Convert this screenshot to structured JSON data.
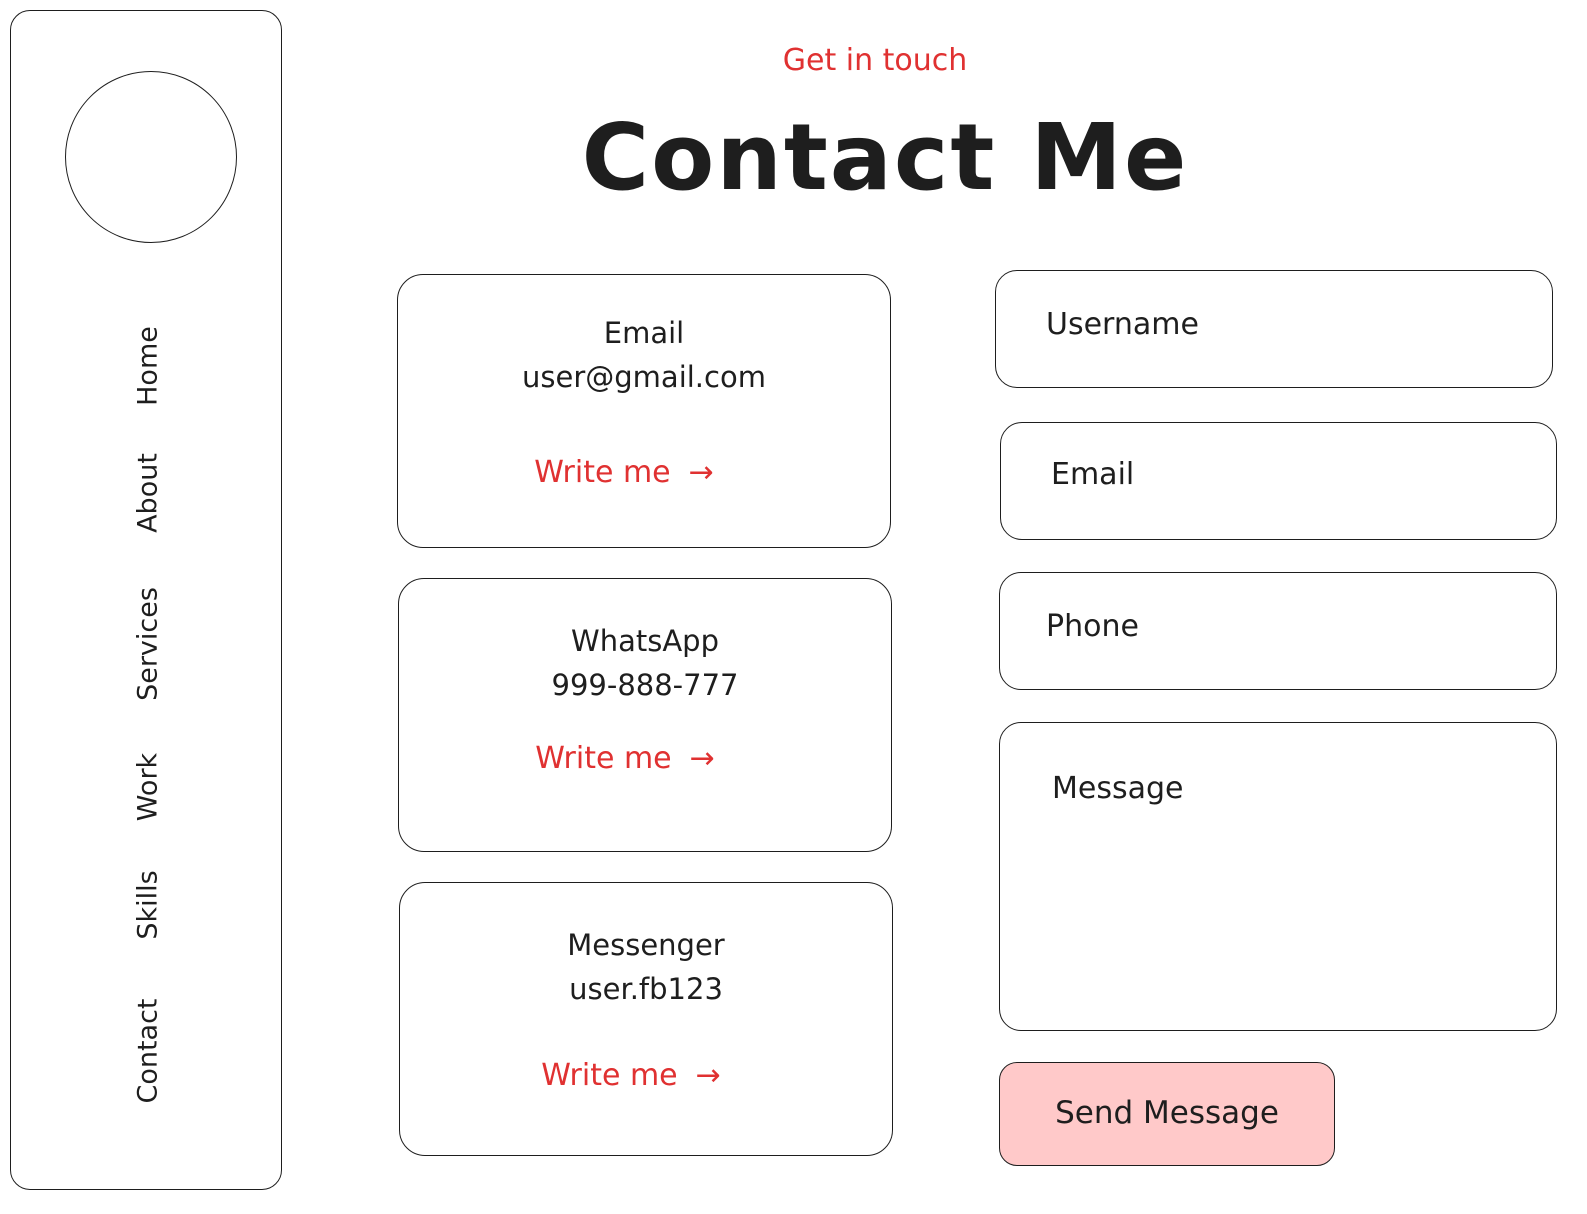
{
  "sidebar": {
    "items": [
      {
        "label": "Home"
      },
      {
        "label": "About"
      },
      {
        "label": "Services"
      },
      {
        "label": "Work"
      },
      {
        "label": "Skills"
      },
      {
        "label": "Contact"
      }
    ]
  },
  "header": {
    "subtitle": "Get in touch",
    "title": "Contact Me"
  },
  "cards": [
    {
      "title": "Email",
      "value": "user@gmail.com",
      "link": "Write me",
      "arrow": "→"
    },
    {
      "title": "WhatsApp",
      "value": "999-888-777",
      "link": "Write me",
      "arrow": "→"
    },
    {
      "title": "Messenger",
      "value": "user.fb123",
      "link": "Write me",
      "arrow": "→"
    }
  ],
  "form": {
    "username_placeholder": "Username",
    "email_placeholder": "Email",
    "phone_placeholder": "Phone",
    "message_placeholder": "Message",
    "submit_label": "Send Message"
  },
  "colors": {
    "accent": "#e03131",
    "button_fill": "#ffc9c9",
    "stroke": "#1e1e1e"
  }
}
